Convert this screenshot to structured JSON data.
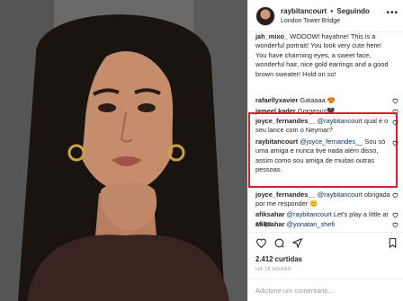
{
  "post": {
    "username": "raybitancourt",
    "dot": "•",
    "follow_label": "Seguindo",
    "location": "London Tower Bridge",
    "more_icon": "more-options-icon"
  },
  "comments": [
    {
      "user": "jah_mixo_",
      "text": "WOOOW! hayahne! This is a wonderful portrait! You look very cute here! You have charming eyes, a sweet face, wonderful hair, nice gold earrings and a good brown sweater! Hold on so!",
      "mention": ""
    },
    {
      "user": "rafaellyxavier",
      "text": "Gataaaa 😍",
      "mention": ""
    },
    {
      "user": "jameel.kader",
      "text": "Gorgeous🖤",
      "mention": ""
    },
    {
      "user": "joyce_fernandes__",
      "mention": "@raybitancourt",
      "text": "qual é o seu lance com o Neymar?"
    },
    {
      "user": "raybitancourt",
      "mention": "@joyce_fernandes__",
      "text": "Sou só uma amiga e nunca tive nada além disso, assim como sou amiga de muitas outras pessoas."
    },
    {
      "user": "joyce_fernandes__",
      "mention": "@raybitancourt",
      "text": "obrigada por me responder 😊"
    },
    {
      "user": "afiksahar",
      "mention": "@raybitancourt",
      "text": "Let's play a little at cs go"
    },
    {
      "user": "afiksahar",
      "mention": "@yonatan_shefi",
      "text": ""
    }
  ],
  "actions": {
    "like_icon": "heart-icon",
    "comment_icon": "comment-icon",
    "share_icon": "share-icon",
    "save_icon": "bookmark-icon"
  },
  "likes_text": "2.412 curtidas",
  "timestamp": "HÁ 18 HORAS",
  "add_comment_placeholder": "Adicione um comentário...",
  "colors": {
    "highlight": "#d0232d",
    "mention": "#003569",
    "timestamp": "#999999"
  }
}
